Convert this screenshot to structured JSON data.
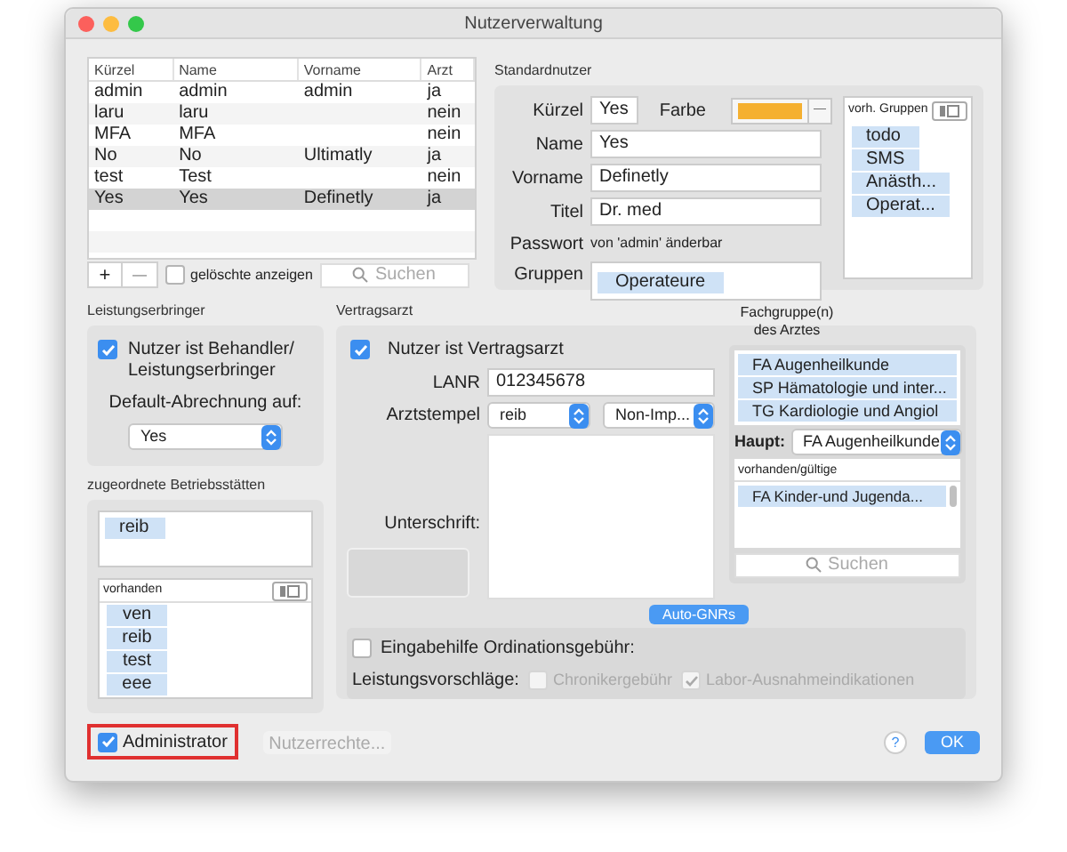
{
  "window": {
    "title": "Nutzerverwaltung"
  },
  "users_table": {
    "columns": [
      "Kürzel",
      "Name",
      "Vorname",
      "Arzt"
    ],
    "rows": [
      {
        "cells": [
          "admin",
          "admin",
          "admin",
          "ja"
        ],
        "selected": false
      },
      {
        "cells": [
          "laru",
          "laru",
          "",
          "nein"
        ],
        "selected": false
      },
      {
        "cells": [
          "MFA",
          "MFA",
          "",
          "nein"
        ],
        "selected": false
      },
      {
        "cells": [
          "No",
          "No",
          "Ultimatly",
          "ja"
        ],
        "selected": false
      },
      {
        "cells": [
          "test",
          "Test",
          "",
          "nein"
        ],
        "selected": false
      },
      {
        "cells": [
          "Yes",
          "Yes",
          "Definetly",
          "ja"
        ],
        "selected": true
      }
    ]
  },
  "table_toolbar": {
    "add": "+",
    "remove": "—",
    "show_deleted": {
      "label": "gelöschte anzeigen",
      "checked": false
    },
    "search": {
      "placeholder": "Suchen"
    }
  },
  "standardnutzer": {
    "title": "Standardnutzer",
    "kuerzel": {
      "label": "Kürzel",
      "value": "Yes"
    },
    "farbe": {
      "label": "Farbe",
      "color": "#f5b030",
      "clear": "—"
    },
    "fields": [
      {
        "label": "Name",
        "value": "Yes"
      },
      {
        "label": "Vorname",
        "value": "Definetly"
      },
      {
        "label": "Titel",
        "value": "Dr. med"
      }
    ],
    "passwort": {
      "label": "Passwort",
      "value": "von 'admin' änderbar"
    },
    "gruppen": {
      "label": "Gruppen",
      "items": [
        "Operateure"
      ]
    },
    "vorh_gruppen": {
      "label": "vorh. Gruppen",
      "items": [
        "todo",
        "SMS",
        "Anästh...",
        "Operat..."
      ]
    }
  },
  "leistungserbringer": {
    "title": "Leistungserbringer",
    "checkbox": {
      "label": "Nutzer ist Behandler/ Leistungserbringer",
      "checked": true
    },
    "default_label": "Default-Abrechnung auf:",
    "default_value": "Yes"
  },
  "betriebsstaetten": {
    "title": "zugeordnete Betriebsstätten",
    "assigned": [
      "reib"
    ],
    "available": {
      "label": "vorhanden",
      "items": [
        "ven",
        "reib",
        "test",
        "eee"
      ]
    }
  },
  "vertragsarzt": {
    "title": "Vertragsarzt",
    "checkbox": {
      "label": "Nutzer ist Vertragsarzt",
      "checked": true
    },
    "lanr": {
      "label": "LANR",
      "value": "012345678"
    },
    "arztstempel": {
      "label": "Arztstempel",
      "value": "reib",
      "second_value": "Non-Imp..."
    },
    "unterschrift": "Unterschrift:",
    "fachgruppen": {
      "label": "Fachgruppe(n) des Arztes",
      "items": [
        "FA Augenheilkunde",
        "SP Hämatologie und inter...",
        "TG Kardiologie und Angiol"
      ],
      "haupt": {
        "label": "Haupt:",
        "value": "FA Augenheilkunde"
      },
      "available": {
        "label": "vorhanden/gültige",
        "items": [
          "FA Kinder-und Jugenda..."
        ]
      },
      "search": {
        "placeholder": "Suchen"
      }
    },
    "auto_gnrs": "Auto-GNRs",
    "ordination": {
      "label": "Eingabehilfe Ordinationsgebühr:",
      "checked": false
    },
    "leistungsvorschlaege": {
      "label": "Leistungsvorschläge:",
      "options": [
        {
          "label": "Chronikergebühr",
          "checked": false,
          "disabled": true
        },
        {
          "label": "Labor-Ausnahmeindikationen",
          "checked": true,
          "disabled": true
        }
      ]
    }
  },
  "footer": {
    "administrator": {
      "label": "Administrator",
      "checked": true
    },
    "nutzerrechte": {
      "label": "Nutzerrechte...",
      "disabled": true
    },
    "help": "?",
    "ok": "OK"
  }
}
